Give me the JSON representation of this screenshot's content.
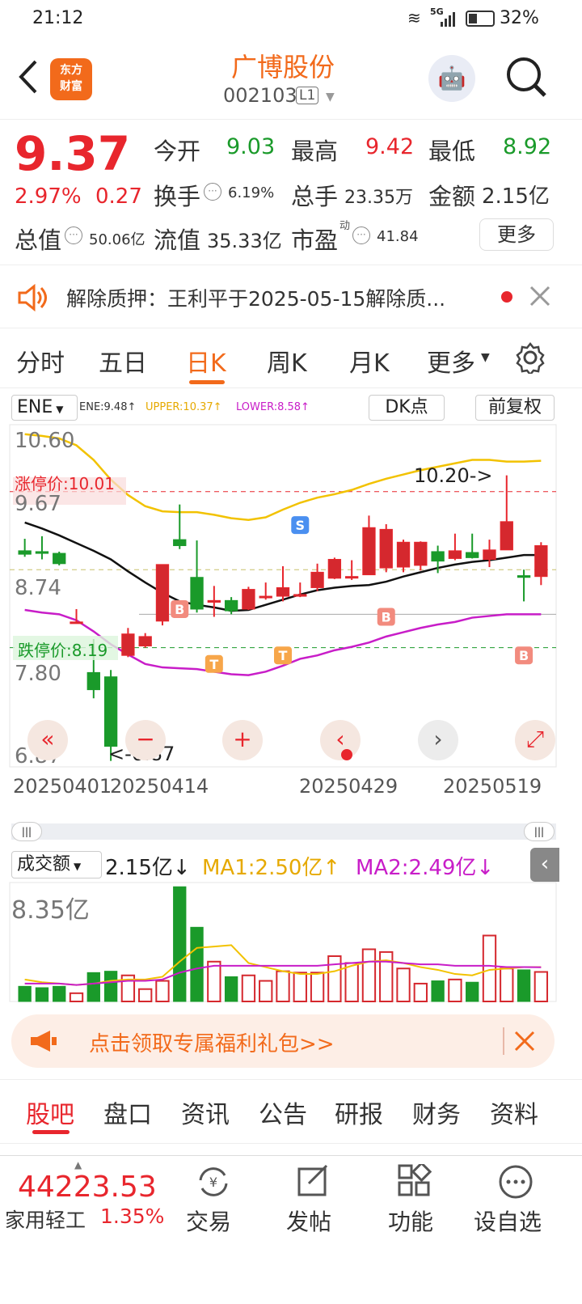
{
  "status_bar": {
    "time": "21:12",
    "battery": "32%",
    "network": "5G"
  },
  "header": {
    "logo_line1": "东方",
    "logo_line2": "财富",
    "stock_name": "广博股份",
    "stock_code": "002103",
    "level_badge": "L1"
  },
  "quote": {
    "price": "9.37",
    "change_pct": "2.97%",
    "change_amt": "0.27",
    "open_label": "今开",
    "open": "9.03",
    "high_label": "最高",
    "high": "9.42",
    "low_label": "最低",
    "low": "8.92",
    "turnover_label": "换手",
    "turnover": "6.19%",
    "volume_label": "总手",
    "volume": "23.35万",
    "amount_label": "金额",
    "amount": "2.15亿",
    "mktcap_label": "总值",
    "mktcap": "50.06亿",
    "float_label": "流值",
    "float_cap": "35.33亿",
    "pe_label": "市盈",
    "pe_sup": "动",
    "pe": "41.84",
    "more_label": "更多"
  },
  "notice": {
    "text": "解除质押：王利平于2025-05-15解除质..."
  },
  "chart_tabs": [
    "分时",
    "五日",
    "日K",
    "周K",
    "月K",
    "更多"
  ],
  "indicator": {
    "name": "ENE",
    "ene": "ENE:9.48↑",
    "upper": "UPPER:10.37↑",
    "lower": "LOWER:8.58↑",
    "dk_label": "DK点",
    "adjust_label": "前复权"
  },
  "chart_data": {
    "type": "candlestick",
    "y_ticks": [
      "10.60",
      "9.67",
      "8.74",
      "7.80",
      "6.87"
    ],
    "limit_up_label": "涨停价:10.01",
    "limit_down_label": "跌停价:8.19",
    "x_ticks": [
      "20250401",
      "20250414",
      "20250429",
      "20250519"
    ],
    "annotations": {
      "max": "10.20->",
      "min": "<-6.87"
    },
    "markers": [
      "B",
      "T",
      "S",
      "T",
      "B",
      "B"
    ],
    "candles": [
      {
        "o": 9.32,
        "c": 9.28,
        "h": 9.46,
        "l": 9.25
      },
      {
        "o": 9.31,
        "c": 9.29,
        "h": 9.49,
        "l": 9.22
      },
      {
        "o": 9.29,
        "c": 9.17,
        "h": 9.31,
        "l": 9.15
      },
      {
        "o": 8.49,
        "c": 8.49,
        "h": 8.64,
        "l": 8.48
      },
      {
        "o": 7.9,
        "c": 7.7,
        "h": 8.29,
        "l": 7.6
      },
      {
        "o": 7.85,
        "c": 7.04,
        "h": 7.93,
        "l": 6.87
      },
      {
        "o": 8.1,
        "c": 8.35,
        "h": 8.42,
        "l": 8.08
      },
      {
        "o": 8.21,
        "c": 8.32,
        "h": 8.36,
        "l": 8.19
      },
      {
        "o": 8.5,
        "c": 9.16,
        "h": 9.16,
        "l": 8.45
      },
      {
        "o": 9.45,
        "c": 9.38,
        "h": 9.86,
        "l": 9.34
      },
      {
        "o": 9.01,
        "c": 8.64,
        "h": 9.44,
        "l": 8.6
      },
      {
        "o": 8.72,
        "c": 8.74,
        "h": 8.91,
        "l": 8.55
      },
      {
        "o": 8.74,
        "c": 8.62,
        "h": 8.78,
        "l": 8.58
      },
      {
        "o": 8.64,
        "c": 8.87,
        "h": 8.9,
        "l": 8.63
      },
      {
        "o": 8.79,
        "c": 8.79,
        "h": 8.95,
        "l": 8.75
      },
      {
        "o": 8.79,
        "c": 8.89,
        "h": 9.14,
        "l": 8.73
      },
      {
        "o": 8.79,
        "c": 8.81,
        "h": 8.95,
        "l": 8.78
      },
      {
        "o": 8.89,
        "c": 9.07,
        "h": 9.17,
        "l": 8.85
      },
      {
        "o": 9.0,
        "c": 9.22,
        "h": 9.24,
        "l": 8.99
      },
      {
        "o": 9.01,
        "c": 9.02,
        "h": 9.21,
        "l": 8.98
      },
      {
        "o": 9.04,
        "c": 9.59,
        "h": 9.73,
        "l": 9.04
      },
      {
        "o": 9.12,
        "c": 9.57,
        "h": 9.63,
        "l": 9.07
      },
      {
        "o": 9.13,
        "c": 9.42,
        "h": 9.45,
        "l": 9.07
      },
      {
        "o": 9.15,
        "c": 9.42,
        "h": 9.43,
        "l": 9.09
      },
      {
        "o": 9.31,
        "c": 9.2,
        "h": 9.38,
        "l": 9.06
      },
      {
        "o": 9.23,
        "c": 9.32,
        "h": 9.52,
        "l": 9.21
      },
      {
        "o": 9.3,
        "c": 9.24,
        "h": 9.52,
        "l": 9.23
      },
      {
        "o": 9.22,
        "c": 9.33,
        "h": 9.45,
        "l": 9.13
      },
      {
        "o": 9.33,
        "c": 9.66,
        "h": 10.2,
        "l": 9.33
      },
      {
        "o": 9.03,
        "c": 9.01,
        "h": 9.1,
        "l": 8.73
      },
      {
        "o": 9.02,
        "c": 9.38,
        "h": 9.42,
        "l": 8.92
      }
    ],
    "ma_line": [
      9.65,
      9.58,
      9.5,
      9.41,
      9.32,
      9.22,
      9.08,
      8.95,
      8.83,
      8.73,
      8.69,
      8.66,
      8.62,
      8.63,
      8.69,
      8.75,
      8.81,
      8.86,
      8.89,
      8.91,
      8.92,
      8.96,
      9.02,
      9.07,
      9.12,
      9.16,
      9.19,
      9.21,
      9.24,
      9.27,
      9.27
    ],
    "upper_line": [
      10.68,
      10.66,
      10.63,
      10.55,
      10.38,
      10.15,
      9.97,
      9.84,
      9.78,
      9.77,
      9.77,
      9.74,
      9.7,
      9.68,
      9.71,
      9.8,
      9.88,
      9.94,
      9.98,
      10.03,
      10.1,
      10.16,
      10.21,
      10.26,
      10.3,
      10.34,
      10.38,
      10.38,
      10.36,
      10.36,
      10.37
    ],
    "lower_line": [
      8.63,
      8.6,
      8.58,
      8.51,
      8.38,
      8.23,
      8.11,
      8.0,
      7.96,
      7.95,
      7.94,
      7.91,
      7.88,
      7.87,
      7.91,
      7.98,
      8.06,
      8.1,
      8.16,
      8.2,
      8.25,
      8.32,
      8.37,
      8.42,
      8.46,
      8.49,
      8.54,
      8.56,
      8.58,
      8.58,
      8.58
    ]
  },
  "volume": {
    "label": "成交额",
    "value": "2.15亿↓",
    "ma1": "MA1:2.50亿↑",
    "ma2": "MA2:2.49亿↓",
    "max_label": "8.35亿",
    "bars": [
      1.1,
      1.0,
      1.1,
      0.6,
      2.1,
      2.2,
      1.9,
      0.9,
      1.5,
      8.35,
      5.4,
      2.9,
      1.8,
      1.9,
      1.5,
      2.2,
      2.1,
      2.1,
      3.3,
      2.8,
      3.8,
      3.6,
      2.4,
      1.3,
      1.5,
      1.6,
      1.4,
      4.8,
      2.4,
      2.3,
      2.15
    ],
    "ma1_line": [
      1.6,
      1.4,
      1.3,
      1.2,
      1.3,
      1.5,
      1.6,
      1.6,
      1.8,
      2.9,
      3.9,
      4.0,
      4.1,
      2.8,
      2.5,
      2.2,
      2.0,
      2.0,
      2.2,
      2.6,
      2.9,
      3.0,
      2.8,
      2.5,
      2.3,
      2.0,
      1.9,
      2.3,
      2.4,
      2.5,
      2.5
    ],
    "ma2_line": [
      1.3,
      1.3,
      1.3,
      1.2,
      1.3,
      1.4,
      1.5,
      1.5,
      1.6,
      2.1,
      2.4,
      2.6,
      2.6,
      2.6,
      2.6,
      2.6,
      2.6,
      2.6,
      2.7,
      2.8,
      2.9,
      2.9,
      2.8,
      2.7,
      2.7,
      2.6,
      2.6,
      2.6,
      2.5,
      2.5,
      2.49
    ]
  },
  "promo": {
    "text": "点击领取专属福利礼包>>"
  },
  "bottom_tabs": [
    "股吧",
    "盘口",
    "资讯",
    "公告",
    "研报",
    "财务",
    "资料"
  ],
  "footer": {
    "index_value": "44223.53",
    "index_name": "家用轻工",
    "index_pct": "1.35%",
    "trade": "交易",
    "post": "发帖",
    "function": "功能",
    "watch": "设自选"
  }
}
